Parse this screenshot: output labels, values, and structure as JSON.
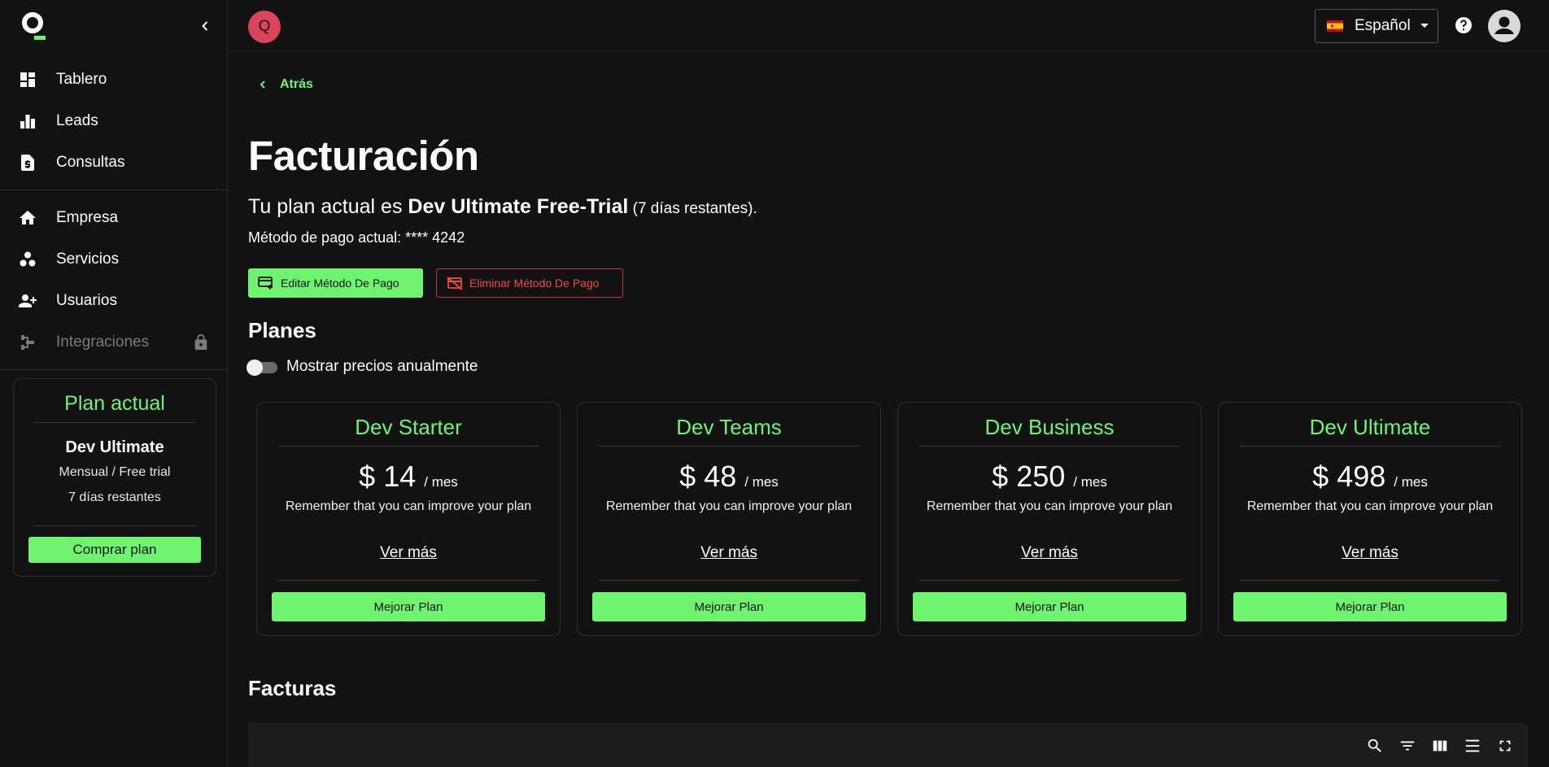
{
  "sidebar": {
    "logo_icon": "q-logo-icon",
    "collapse_icon": "chevron-left-icon",
    "items": [
      {
        "label": "Tablero",
        "icon": "dashboard-icon"
      },
      {
        "label": "Leads",
        "icon": "bar-chart-icon"
      },
      {
        "label": "Consultas",
        "icon": "invoice-icon"
      },
      {
        "label": "Empresa",
        "icon": "home-icon"
      },
      {
        "label": "Servicios",
        "icon": "services-icon"
      },
      {
        "label": "Usuarios",
        "icon": "add-user-icon"
      },
      {
        "label": "Integraciones",
        "icon": "integrations-icon",
        "disabled": true,
        "locked": true
      }
    ],
    "plan_card": {
      "title": "Plan actual",
      "plan_name": "Dev Ultimate",
      "billing": "Mensual / Free trial",
      "remaining": "7 días restantes",
      "button": "Comprar plan"
    }
  },
  "topbar": {
    "avatar_letter": "Q",
    "language": "Español",
    "language_flag": "spain-flag-icon",
    "help_icon": "help-icon",
    "user_icon": "account-icon"
  },
  "main": {
    "back_label": "Atrás",
    "title": "Facturación",
    "plan_prefix": "Tu plan actual es ",
    "plan_name": "Dev Ultimate Free-Trial",
    "plan_suffix": " (7 días restantes).",
    "payment_method": "Método de pago actual: **** 4242",
    "edit_payment_button": "Editar Método De Pago",
    "delete_payment_button": "Eliminar Método De Pago",
    "plans_title": "Planes",
    "annual_toggle_label": "Mostrar precios anualmente",
    "annual_toggle_on": false,
    "plans": [
      {
        "name": "Dev Starter",
        "amount": "$ 14",
        "per": "/ mes",
        "description": "Remember that you can improve your plan",
        "more": "Ver más",
        "button": "Mejorar Plan"
      },
      {
        "name": "Dev Teams",
        "amount": "$ 48",
        "per": "/ mes",
        "description": "Remember that you can improve your plan",
        "more": "Ver más",
        "button": "Mejorar Plan"
      },
      {
        "name": "Dev Business",
        "amount": "$ 250",
        "per": "/ mes",
        "description": "Remember that you can improve your plan",
        "more": "Ver más",
        "button": "Mejorar Plan"
      },
      {
        "name": "Dev Ultimate",
        "amount": "$ 498",
        "per": "/ mes",
        "description": "Remember that you can improve your plan",
        "more": "Ver más",
        "button": "Mejorar Plan"
      }
    ],
    "invoices_title": "Facturas",
    "table_tools": [
      "search-icon",
      "filter-icon",
      "columns-icon",
      "density-icon",
      "fullscreen-icon"
    ]
  },
  "colors": {
    "accent": "#6ff46f",
    "danger": "#f24b3f",
    "avatar": "#d9445a",
    "background": "#121212"
  }
}
